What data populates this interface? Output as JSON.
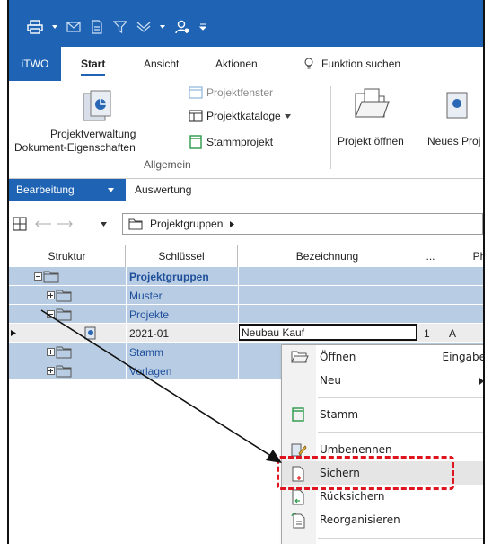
{
  "ribbon_tabs": {
    "itwo": "iTWO",
    "start": "Start",
    "ansicht": "Ansicht",
    "aktionen": "Aktionen",
    "funktion": "Funktion suchen"
  },
  "ribbon": {
    "projektverwaltung": "Projektverwaltung",
    "dokument": "Dokument-Eigenschaften",
    "projektfenster": "Projektfenster",
    "projektkataloge": "Projektkataloge",
    "stammprojekt": "Stammprojekt",
    "allgemein": "Allgemein",
    "projekt_oeffnen": "Projekt öffnen",
    "neues_projekt": "Neues Proj"
  },
  "strip": {
    "bearbeitung": "Bearbeitung",
    "auswertung": "Auswertung"
  },
  "nav": {
    "path": "Projektgruppen"
  },
  "grid": {
    "headers": {
      "struktur": "Struktur",
      "schluessel": "Schlüssel",
      "bezeichnung": "Bezeichnung",
      "dots": "...",
      "pha": "Pha"
    },
    "rows": [
      {
        "key": "Projektgruppen"
      },
      {
        "key": "Muster"
      },
      {
        "key": "Projekte"
      },
      {
        "key": "2021-01",
        "bez": "Neubau Kauf",
        "extra": "1",
        "extra2": "A"
      },
      {
        "key": "Stamm"
      },
      {
        "key": "Vorlagen"
      }
    ]
  },
  "menu": {
    "oeffnen": "Öffnen",
    "eingabe": "Eingabe",
    "neu": "Neu",
    "stamm": "Stamm",
    "umbenennen": "Umbenennen",
    "sichern": "Sichern",
    "ruecksichern": "Rücksichern",
    "reorganisieren": "Reorganisieren"
  },
  "colors": {
    "brand": "#1f64b4",
    "row": "#b8cde4",
    "highlight": "#e0141e"
  }
}
